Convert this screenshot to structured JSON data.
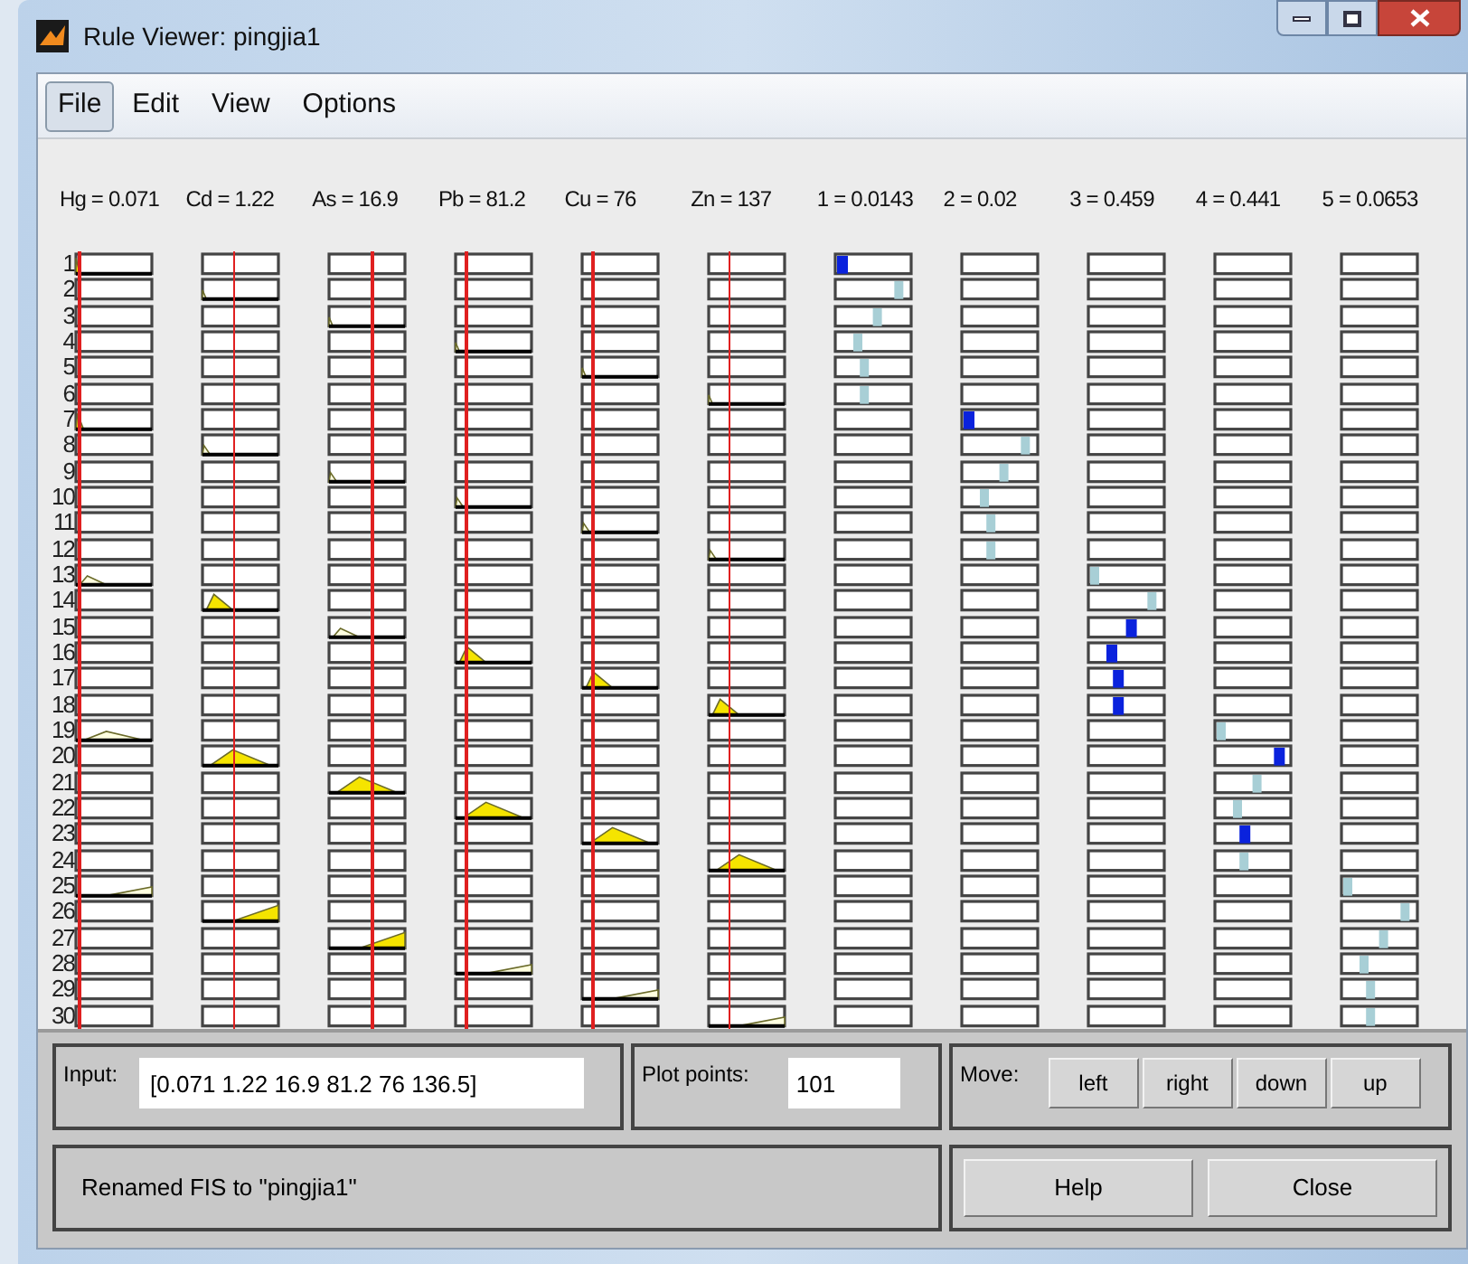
{
  "window": {
    "title": "Rule Viewer: pingjia1"
  },
  "menu": [
    {
      "label": "File",
      "selected": true
    },
    {
      "label": "Edit",
      "selected": false
    },
    {
      "label": "View",
      "selected": false
    },
    {
      "label": "Options",
      "selected": false
    }
  ],
  "variables": [
    {
      "kind": "input",
      "label": "Hg = 0.071"
    },
    {
      "kind": "input",
      "label": "Cd = 1.22"
    },
    {
      "kind": "input",
      "label": "As = 16.9"
    },
    {
      "kind": "input",
      "label": "Pb = 81.2"
    },
    {
      "kind": "input",
      "label": "Cu = 76"
    },
    {
      "kind": "input",
      "label": "Zn = 137"
    },
    {
      "kind": "output",
      "label": "1 = 0.0143"
    },
    {
      "kind": "output",
      "label": "2 = 0.02"
    },
    {
      "kind": "output",
      "label": "3 = 0.459"
    },
    {
      "kind": "output",
      "label": "4 = 0.441"
    },
    {
      "kind": "output",
      "label": "5 = 0.0653"
    }
  ],
  "rule_numbers": [
    "1",
    "2",
    "3",
    "4",
    "5",
    "6",
    "7",
    "8",
    "9",
    "10",
    "11",
    "12",
    "13",
    "14",
    "15",
    "16",
    "17",
    "18",
    "19",
    "20",
    "21",
    "22",
    "23",
    "24",
    "25",
    "26",
    "27",
    "28",
    "29",
    "30"
  ],
  "input": {
    "label": "Input:",
    "value": "[0.071 1.22 16.9 81.2 76 136.5]"
  },
  "plot_points": {
    "label": "Plot points:",
    "value": "101"
  },
  "move": {
    "label": "Move:",
    "buttons": [
      "left",
      "right",
      "down",
      "up"
    ]
  },
  "status": "Renamed FIS to \"pingjia1\"",
  "buttons": [
    "Help",
    "Close"
  ]
}
